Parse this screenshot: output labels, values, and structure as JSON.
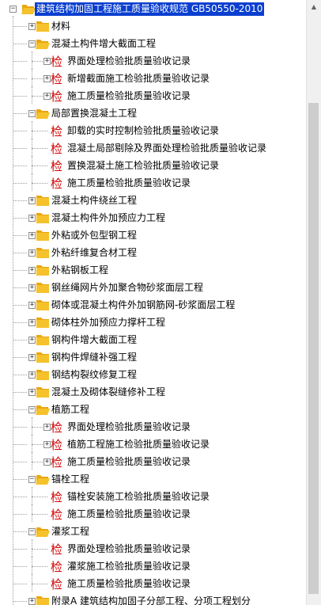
{
  "tree": {
    "nodes": [
      {
        "label": "建筑结构加固工程施工质量验收规范 GB50550-2010",
        "level": 0,
        "type": "folder",
        "toggle": "minus",
        "selected": true
      },
      {
        "label": "材料",
        "level": 1,
        "type": "folder",
        "toggle": "plus"
      },
      {
        "label": "混凝土构件增大截面工程",
        "level": 1,
        "type": "folder",
        "toggle": "minus"
      },
      {
        "label": "界面处理检验批质量验收记录",
        "level": 2,
        "type": "check",
        "toggle": "plus"
      },
      {
        "label": "新增截面施工检验批质量验收记录",
        "level": 2,
        "type": "check",
        "toggle": "plus"
      },
      {
        "label": "施工质量检验批质量验收记录",
        "level": 2,
        "type": "check",
        "toggle": "plus"
      },
      {
        "label": "局部置换混凝土工程",
        "level": 1,
        "type": "folder",
        "toggle": "minus"
      },
      {
        "label": "卸载的实时控制检验批质量验收记录",
        "level": 2,
        "type": "check"
      },
      {
        "label": "混凝土局部剔除及界面处理检验批质量验收记录",
        "level": 2,
        "type": "check"
      },
      {
        "label": "置换混凝土施工检验批质量验收记录",
        "level": 2,
        "type": "check"
      },
      {
        "label": "施工质量检验批质量验收记录",
        "level": 2,
        "type": "check"
      },
      {
        "label": "混凝土构件绕丝工程",
        "level": 1,
        "type": "folder",
        "toggle": "plus"
      },
      {
        "label": "混凝土构件外加预应力工程",
        "level": 1,
        "type": "folder",
        "toggle": "plus"
      },
      {
        "label": "外粘或外包型钢工程",
        "level": 1,
        "type": "folder",
        "toggle": "plus"
      },
      {
        "label": "外粘纤维复合材工程",
        "level": 1,
        "type": "folder",
        "toggle": "plus"
      },
      {
        "label": "外粘钢板工程",
        "level": 1,
        "type": "folder",
        "toggle": "plus"
      },
      {
        "label": "钢丝绳网片外加聚合物砂浆面层工程",
        "level": 1,
        "type": "folder",
        "toggle": "plus"
      },
      {
        "label": "砌体或混凝土构件外加钢筋网-砂浆面层工程",
        "level": 1,
        "type": "folder",
        "toggle": "plus"
      },
      {
        "label": "砌体柱外加预应力撑杆工程",
        "level": 1,
        "type": "folder",
        "toggle": "plus"
      },
      {
        "label": "钢构件增大截面工程",
        "level": 1,
        "type": "folder",
        "toggle": "plus"
      },
      {
        "label": "钢构件焊缝补强工程",
        "level": 1,
        "type": "folder",
        "toggle": "plus"
      },
      {
        "label": "钢结构裂纹修复工程",
        "level": 1,
        "type": "folder",
        "toggle": "plus"
      },
      {
        "label": "混凝土及砌体裂缝修补工程",
        "level": 1,
        "type": "folder",
        "toggle": "plus"
      },
      {
        "label": "植筋工程",
        "level": 1,
        "type": "folder",
        "toggle": "minus"
      },
      {
        "label": "界面处理检验批质量验收记录",
        "level": 2,
        "type": "check",
        "toggle": "plus"
      },
      {
        "label": "植筋工程施工检验批质量验收记录",
        "level": 2,
        "type": "check",
        "toggle": "plus"
      },
      {
        "label": "施工质量检验批质量验收记录",
        "level": 2,
        "type": "check",
        "toggle": "plus"
      },
      {
        "label": "锚栓工程",
        "level": 1,
        "type": "folder",
        "toggle": "minus"
      },
      {
        "label": "锚栓安装施工检验批质量验收记录",
        "level": 2,
        "type": "check"
      },
      {
        "label": "施工质量检验批质量验收记录",
        "level": 2,
        "type": "check"
      },
      {
        "label": "灌浆工程",
        "level": 1,
        "type": "folder",
        "toggle": "minus"
      },
      {
        "label": "界面处理检验批质量验收记录",
        "level": 2,
        "type": "check"
      },
      {
        "label": "灌浆施工检验批质量验收记录",
        "level": 2,
        "type": "check"
      },
      {
        "label": "施工质量检验批质量验收记录",
        "level": 2,
        "type": "check"
      },
      {
        "label": "附录A 建筑结构加固子分部工程、分项工程划分",
        "level": 1,
        "type": "folder",
        "toggle": "plus"
      }
    ]
  },
  "icons": {
    "folder": "folder-icon",
    "check": "inspection-record-icon",
    "check_glyph": "检"
  },
  "colors": {
    "selection": "#0a3fcf",
    "check_icon": "#d40000",
    "folder_yellow": "#f5c22b"
  }
}
